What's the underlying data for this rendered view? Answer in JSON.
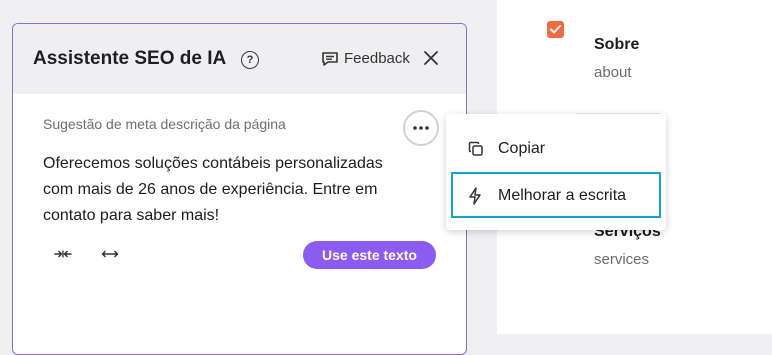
{
  "panel": {
    "title": "Assistente SEO de IA",
    "help_icon": "question-circle-icon",
    "feedback_label": "Feedback",
    "feedback_icon": "chat-icon",
    "close_icon": "close-icon",
    "accent_color": "#8a5cf0"
  },
  "suggestion": {
    "label": "Sugestão de meta descrição da página",
    "text": "Oferecemos soluções contábeis personalizadas com mais de 26 anos de experiência. Entre em contato para saber mais!",
    "use_button_label": "Use este texto",
    "shorten_icon": "shorten-icon",
    "expand_icon": "expand-icon",
    "more_icon": "more-horizontal-icon"
  },
  "menu": {
    "items": [
      {
        "label": "Copiar",
        "icon": "copy-icon"
      },
      {
        "label": "Melhorar a escrita",
        "icon": "lightning-icon"
      }
    ],
    "highlight_color": "#13a7c7"
  },
  "pages": {
    "items": [
      {
        "title": "Sobre",
        "slug": "about",
        "checked": true
      },
      {
        "title": "Serviços",
        "slug": "services",
        "checked": false
      }
    ],
    "checkbox_color": "#f26a3d"
  }
}
